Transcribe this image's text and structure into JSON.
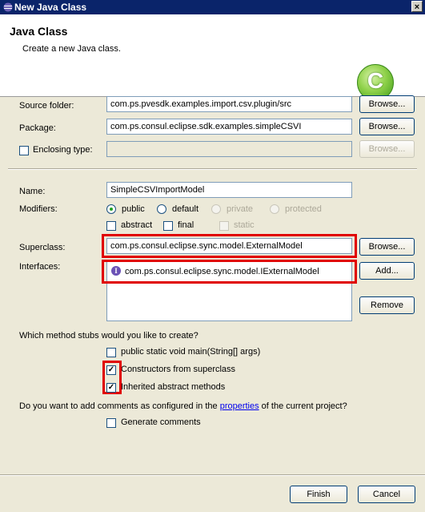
{
  "window": {
    "title": "New Java Class",
    "close_glyph": "×"
  },
  "header": {
    "title": "Java Class",
    "subtitle": "Create a new Java class.",
    "logo_letter": "C"
  },
  "source_folder": {
    "label": "Source folder:",
    "value": "com.ps.pvesdk.examples.import.csv.plugin/src",
    "browse": "Browse..."
  },
  "package": {
    "label": "Package:",
    "value": "com.ps.consul.eclipse.sdk.examples.simpleCSVI",
    "browse": "Browse..."
  },
  "enclosing": {
    "label": "Enclosing type:",
    "value": "",
    "browse": "Browse..."
  },
  "name": {
    "label": "Name:",
    "value": "SimpleCSVImportModel"
  },
  "modifiers": {
    "label": "Modifiers:",
    "public": "public",
    "default": "default",
    "private": "private",
    "protected": "protected",
    "abstract": "abstract",
    "final": "final",
    "static": "static"
  },
  "superclass": {
    "label": "Superclass:",
    "value": "com.ps.consul.eclipse.sync.model.ExternalModel",
    "browse": "Browse..."
  },
  "interfaces": {
    "label": "Interfaces:",
    "items": [
      "com.ps.consul.eclipse.sync.model.IExternalModel"
    ],
    "add": "Add...",
    "remove": "Remove"
  },
  "stubs": {
    "question": "Which method stubs would you like to create?",
    "main": "public static void main(String[] args)",
    "constructors": "Constructors from superclass",
    "inherited": "Inherited abstract methods"
  },
  "comments": {
    "question_pre": "Do you want to add comments as configured in the ",
    "link": "properties",
    "question_post": " of the current project?",
    "generate": "Generate comments"
  },
  "footer": {
    "finish": "Finish",
    "cancel": "Cancel"
  },
  "check_mark": "✓",
  "colors": {
    "title_bar": "#0a246a",
    "highlight": "#e00000",
    "logo": "#3d9a18"
  }
}
